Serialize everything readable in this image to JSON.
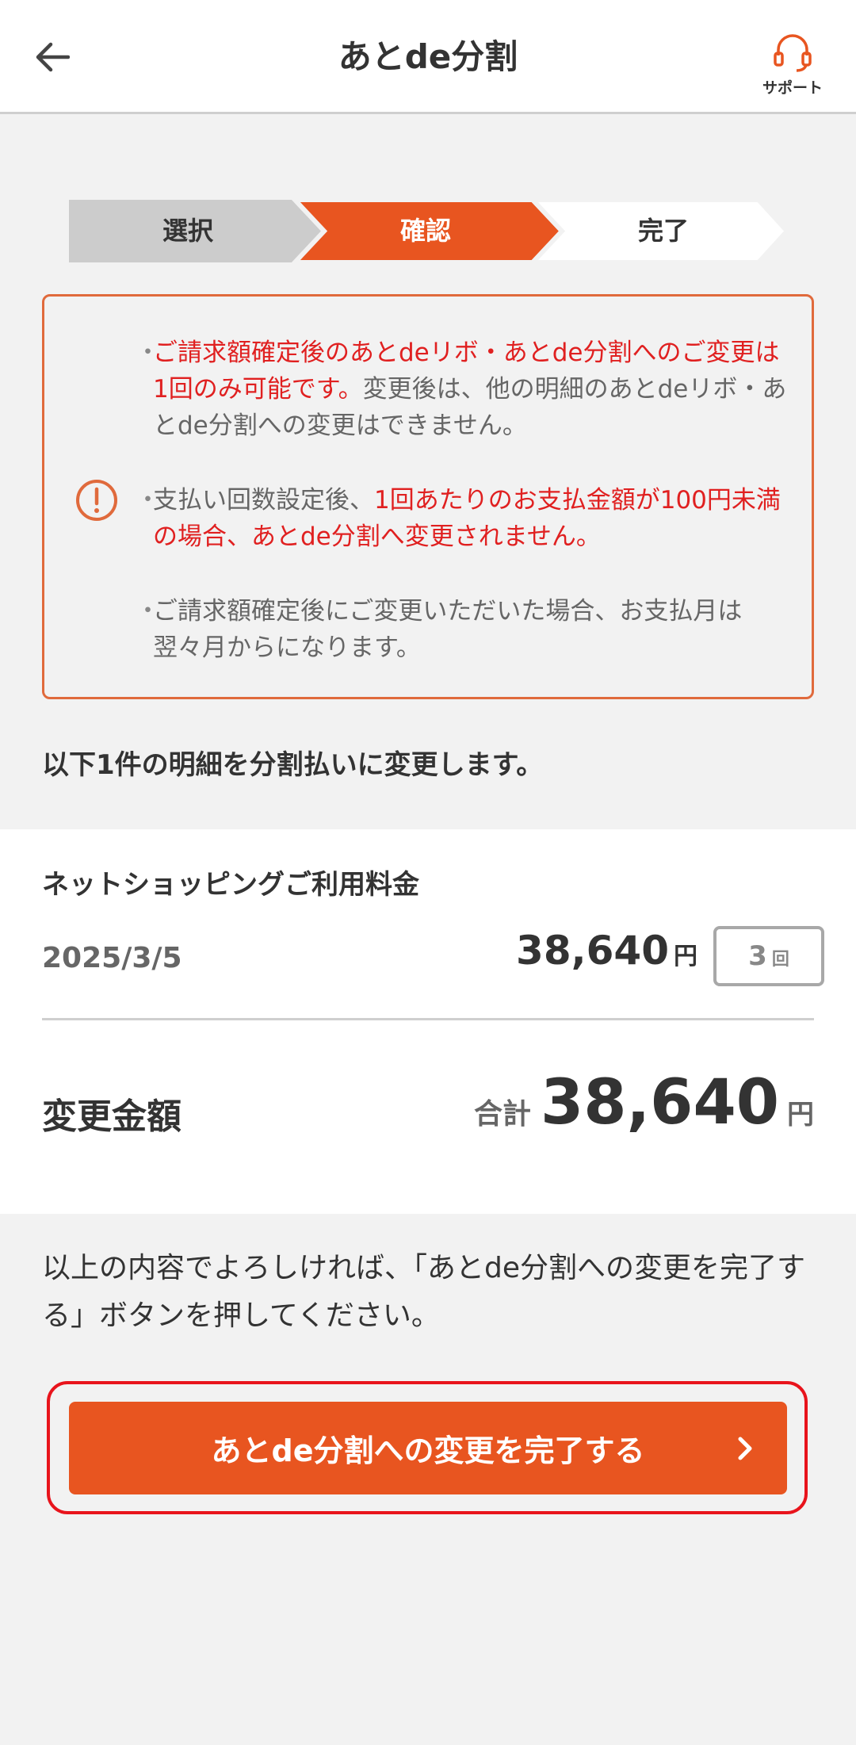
{
  "header": {
    "title": "あとde分割",
    "support_label": "サポート"
  },
  "stepper": {
    "steps": [
      {
        "label": "選択",
        "state": "done"
      },
      {
        "label": "確認",
        "state": "current"
      },
      {
        "label": "完了",
        "state": "todo"
      }
    ],
    "colors": {
      "done": "#cccccc",
      "current": "#e85520",
      "todo": "#ffffff"
    }
  },
  "notice": {
    "items": [
      {
        "red": "ご請求額確定後のあとdeリボ・あとde分割へのご変更は1回のみ可能です。",
        "normal": "変更後は、他の明細のあとdeリボ・あとde分割への変更はできません。"
      },
      {
        "prefix": "支払い回数設定後、",
        "red": "1回あたりのお支払金額が100円未満の場合、あとde分割へ変更されません。"
      },
      {
        "normal": "ご請求額確定後にご変更いただいた場合、お支払月は翌々月からになります。"
      }
    ]
  },
  "intro_text": "以下1件の明細を分割払いに変更します。",
  "item": {
    "title": "ネットショッピングご利用料金",
    "date": "2025/3/5",
    "amount": "38,640",
    "yen": "円",
    "count": "3",
    "count_unit": "回"
  },
  "total": {
    "label": "変更金額",
    "prefix": "合計",
    "amount": "38,640",
    "yen": "円"
  },
  "instruction": "以上の内容でよろしければ、「あとde分割への変更を完了する」ボタンを押してください。",
  "complete_button": {
    "label": "あとde分割への変更を完了する"
  },
  "colors": {
    "accent": "#e85520",
    "notice_red": "#e02020",
    "highlight_red": "#e8141c"
  }
}
